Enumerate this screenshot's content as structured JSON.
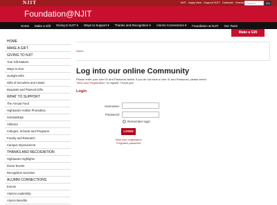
{
  "utility": {
    "logo": "NJIT",
    "links": [
      "NJIT",
      "Apply Now",
      "Support NJIT",
      "Calendar",
      "Directory"
    ],
    "search_placeholder": "Search",
    "go_label": "Go"
  },
  "header": {
    "title": "Foundation@NJIT"
  },
  "nav": {
    "items": [
      "Home",
      "Make a Gift",
      "Giving to NJIT",
      "Ways to Support",
      "Thanks and Recognition",
      "Alumni Connections",
      "Foundation at NJIT",
      "Our Team"
    ],
    "give_button": "Make a Gift"
  },
  "sidebar": {
    "items": [
      {
        "label": "HOME",
        "head": true
      },
      {
        "label": "MAKE A GIFT",
        "head": true
      },
      {
        "label": "GIVING TO NJIT",
        "head": true
      },
      {
        "label": "Your Gift Matters",
        "head": false
      },
      {
        "label": "Ways to Give",
        "head": false
      },
      {
        "label": "Outright Gifts",
        "head": false
      },
      {
        "label": "Gifts of Securities and Assets",
        "head": false
      },
      {
        "label": "Bequests and Planned Gifts",
        "head": false
      },
      {
        "label": "WHAT TO SUPPORT",
        "head": true
      },
      {
        "label": "The Annual Fund",
        "head": false
      },
      {
        "label": "Highlander Hotline Phonathon",
        "head": false
      },
      {
        "label": "Scholarships",
        "head": false
      },
      {
        "label": "Athletics",
        "head": false
      },
      {
        "label": "Colleges, Schools and Programs",
        "head": false
      },
      {
        "label": "Faculty and Research",
        "head": false
      },
      {
        "label": "Campus Improvement",
        "head": false
      },
      {
        "label": "THANKS AND RECOGNITION",
        "head": true
      },
      {
        "label": "Highlander Highlights",
        "head": false
      },
      {
        "label": "Donor Events",
        "head": false
      },
      {
        "label": "Recognition Societies",
        "head": false
      },
      {
        "label": "ALUMNI CONNECTIONS",
        "head": true
      },
      {
        "label": "Events",
        "head": false
      },
      {
        "label": "Alumni Leadership",
        "head": false
      },
      {
        "label": "Alumni Benefits",
        "head": false
      }
    ]
  },
  "breadcrumb": {
    "home": "Home"
  },
  "main": {
    "title": "Log into our online Community",
    "intro_before": "Please enter your User ID and Password below.  If you do not have a User ID and Password, please select",
    "intro_link": "\"New User Registration\"",
    "intro_after": " to register.  Thank you!",
    "login_heading": "Login",
    "username_label": "Username:",
    "password_label": "Password:",
    "remember_label": "Remember login",
    "login_button": "LOGIN",
    "new_user_link": "New user registration",
    "forgotten_link": "Forgotten password"
  }
}
